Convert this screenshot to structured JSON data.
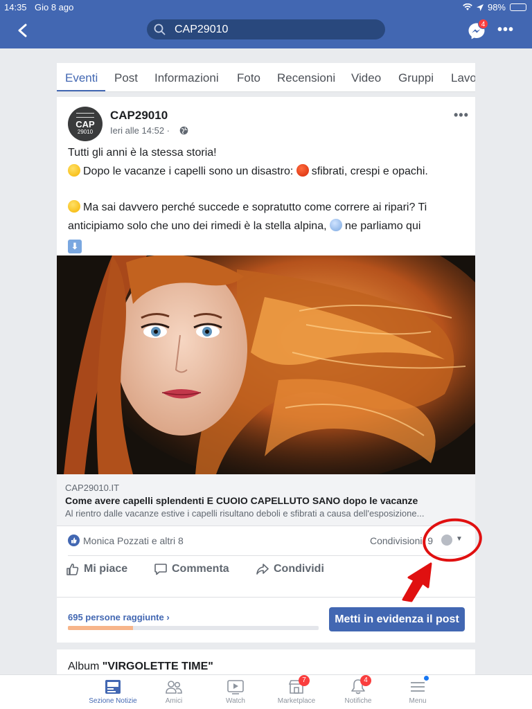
{
  "status_bar": {
    "time": "14:35",
    "date": "Gio 8 ago",
    "battery": "98%"
  },
  "header": {
    "search_value": "CAP29010",
    "messenger_badge": "4"
  },
  "tabs": [
    {
      "label": "Eventi",
      "active": true
    },
    {
      "label": "Post"
    },
    {
      "label": "Informazioni"
    },
    {
      "label": "Foto"
    },
    {
      "label": "Recensioni"
    },
    {
      "label": "Video"
    },
    {
      "label": "Gruppi"
    },
    {
      "label": "Lavo"
    }
  ],
  "post": {
    "page_name": "CAP29010",
    "avatar_text": "CAP",
    "avatar_sub": "29010",
    "time": "Ieri alle 14:52 ·",
    "text_line1": "Tutti gli anni è la stessa storia!",
    "text_line2a": "Dopo le vacanze i capelli sono un disastro: ",
    "text_line2b": "sfibrati, crespi e opachi.",
    "text_line3": "Ma sai davvero perché succede e sopratutto come correre ai ripari? Ti anticipiamo solo che uno dei rimedi è la stella alpina, ",
    "text_line3b": "ne parliamo qui",
    "arrow_glyph": "⬇",
    "link": {
      "domain": "CAP29010.IT",
      "title": "Come avere capelli splendenti E CUOIO CAPELLUTO SANO dopo le vacanze",
      "description": "Al rientro dalle vacanze estive i capelli risultano deboli e sfibrati a causa dell'esposizione..."
    },
    "reactions_text": "Monica Pozzati e altri 8",
    "shares_text": "Condivisioni: 9",
    "actions": {
      "like": "Mi piace",
      "comment": "Commenta",
      "share": "Condividi"
    },
    "reach_text": "695 persone raggiunte ›",
    "reach_fraction": 0.26,
    "boost_label": "Metti in evidenza il post"
  },
  "album": {
    "prefix": "Album ",
    "name": "\"VIRGOLETTE TIME\""
  },
  "bottom_nav": [
    {
      "label": "Sezione Notizie",
      "icon": "news-feed-icon",
      "active": true
    },
    {
      "label": "Amici",
      "icon": "friends-icon"
    },
    {
      "label": "Watch",
      "icon": "watch-icon"
    },
    {
      "label": "Marketplace",
      "icon": "marketplace-icon",
      "badge": "7"
    },
    {
      "label": "Notifiche",
      "icon": "bell-icon",
      "badge": "4"
    },
    {
      "label": "Menu",
      "icon": "menu-icon"
    }
  ],
  "colors": {
    "brand": "#4267b2",
    "annotation": "#e01010"
  }
}
